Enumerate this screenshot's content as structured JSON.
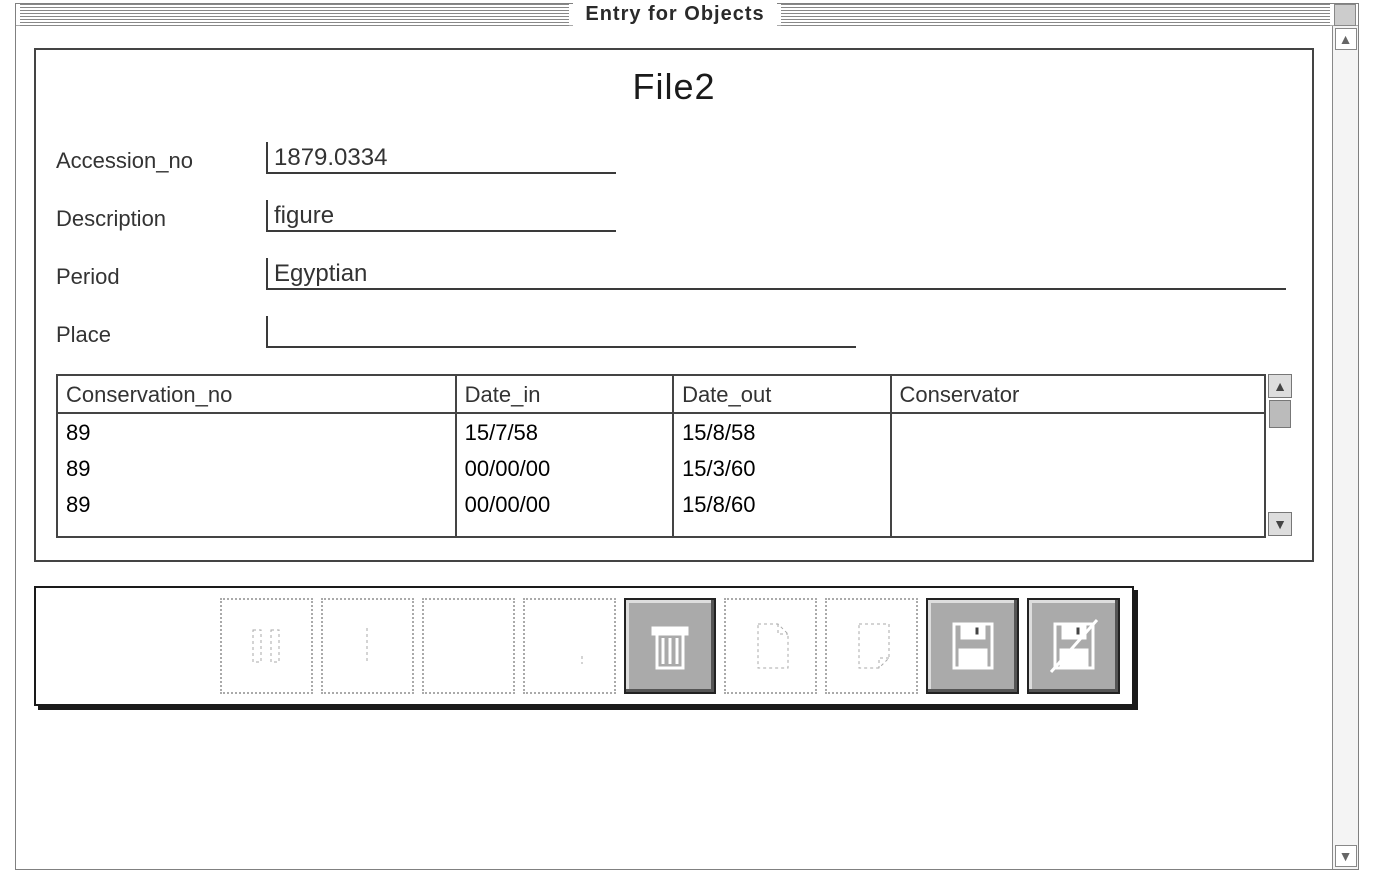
{
  "window": {
    "title": "Entry for Objects"
  },
  "form": {
    "title": "File2",
    "labels": {
      "accession_no": "Accession_no",
      "description": "Description",
      "period": "Period",
      "place": "Place"
    },
    "values": {
      "accession_no": "1879.0334",
      "description": "figure",
      "period": "Egyptian",
      "place": ""
    }
  },
  "table": {
    "headers": [
      "Conservation_no",
      "Date_in",
      "Date_out",
      "Conservator"
    ],
    "rows": [
      {
        "conservation_no": "89",
        "date_in": "15/7/58",
        "date_out": "15/8/58",
        "conservator": ""
      },
      {
        "conservation_no": "89",
        "date_in": "00/00/00",
        "date_out": "15/3/60",
        "conservator": ""
      },
      {
        "conservation_no": "89",
        "date_in": "00/00/00",
        "date_out": "15/8/60",
        "conservator": ""
      }
    ]
  },
  "toolbar": {
    "icons": [
      "pause",
      "divider",
      "blank",
      "alt",
      "trash",
      "new-page",
      "page",
      "save",
      "save-cancel"
    ]
  }
}
